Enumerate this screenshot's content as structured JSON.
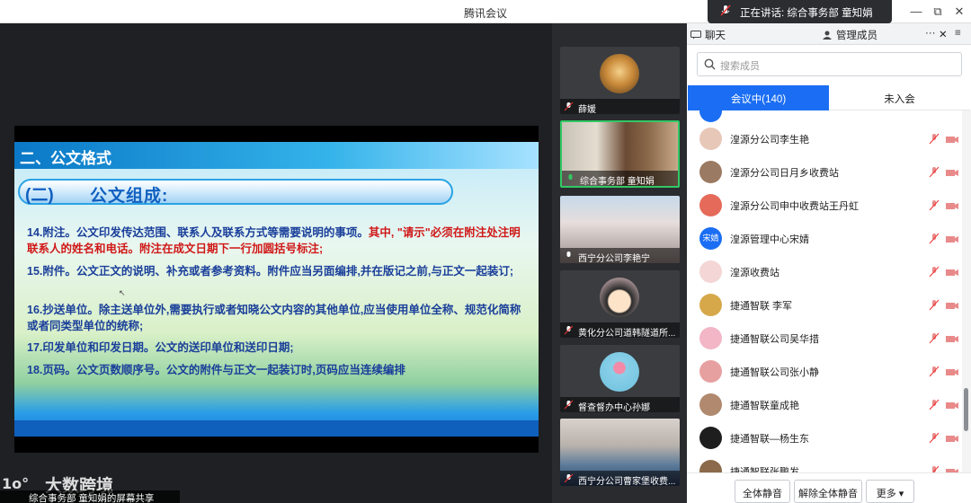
{
  "app": {
    "title": "腾讯会议"
  },
  "speaking": {
    "label": "正在讲话: 综合事务部 童知娟"
  },
  "window_controls": {
    "minimize": "—",
    "maximize": "⧉",
    "close": "✕"
  },
  "slide": {
    "header": "二、公文格式",
    "section_num": "(二)",
    "section_title": "公文组成:",
    "p14_a": "14.附注。公文印发传达范围、联系人及联系方式等需要说明的事项。",
    "p14_b": "其中, \"请示\"必须在附注处注明联系人的姓名和电话。附注在成文日期下一行加圆括号标注;",
    "p15": "15.附件。公文正文的说明、补充或者参考资料。附件应当另面编排,并在版记之前,与正文一起装订;",
    "p16": "16.抄送单位。除主送单位外,需要执行或者知晓公文内容的其他单位,应当使用单位全称、规范化简称或者同类型单位的统称;",
    "p17": "17.印发单位和印发日期。公文的送印单位和送印日期;",
    "p18": "18.页码。公文页数顺序号。公文的附件与正文一起装订时,页码应当连续编排"
  },
  "videos": [
    {
      "name": "薛媛",
      "active": false
    },
    {
      "name": "综合事务部 童知娟",
      "active": true
    },
    {
      "name": "西宁分公司李艳宁",
      "active": false
    },
    {
      "name": "黄化分公司道韩隧道所...",
      "active": false
    },
    {
      "name": "督查督办中心孙娜",
      "active": false
    },
    {
      "name": "西宁分公司曹家堡收费...",
      "active": false
    }
  ],
  "panel": {
    "tab_chat": "聊天",
    "tab_members": "管理成员",
    "more": "···",
    "close": "✕",
    "menu": "≡",
    "search_placeholder": "搜索成员",
    "seg_in_meeting": "会议中(140)",
    "seg_not_joined": "未入会",
    "members": [
      {
        "name": "湟源分公司李生艳",
        "avatar_text": "",
        "color": "#e7c7b8"
      },
      {
        "name": "湟源分公司日月乡收费站",
        "avatar_text": "",
        "color": "#9a7a62"
      },
      {
        "name": "湟源分公司申中收费站王丹虹",
        "avatar_text": "",
        "color": "#e56a5a"
      },
      {
        "name": "湟源管理中心宋婧",
        "avatar_text": "宋婧",
        "color": "#1b6ef3"
      },
      {
        "name": "湟源收费站",
        "avatar_text": "",
        "color": "#f4d6d6"
      },
      {
        "name": "捷通智联 李军",
        "avatar_text": "",
        "color": "#d6a84a"
      },
      {
        "name": "捷通智联公司吴华措",
        "avatar_text": "",
        "color": "#f2b6c6"
      },
      {
        "name": "捷通智联公司张小静",
        "avatar_text": "",
        "color": "#e7a0a0"
      },
      {
        "name": "捷通智联童成艳",
        "avatar_text": "",
        "color": "#b0896e"
      },
      {
        "name": "捷通智联—杨生东",
        "avatar_text": "",
        "color": "#1e1e1e"
      },
      {
        "name": "捷通智联张鹏发",
        "avatar_text": "",
        "color": "#8a6a4a"
      }
    ],
    "btn_mute_all": "全体静音",
    "btn_unmute_all": "解除全体静音",
    "btn_more": "更多 ▾"
  },
  "status": {
    "share_label": "综合事务部 童知娟的屏幕共享"
  },
  "watermark": {
    "text": "大数跨境"
  }
}
